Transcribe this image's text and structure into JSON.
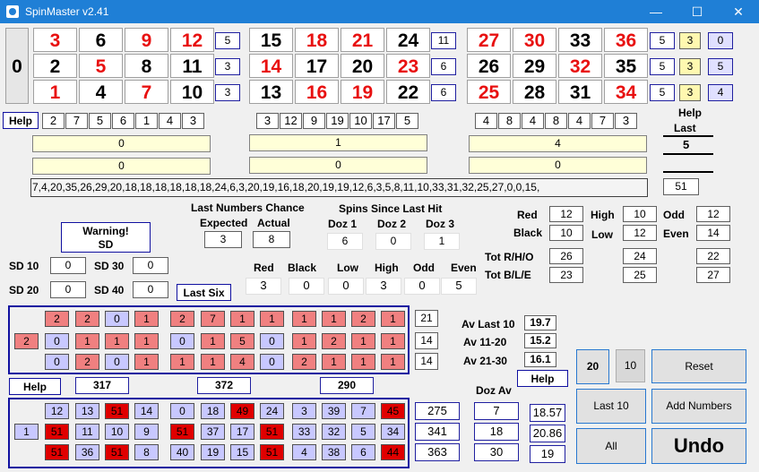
{
  "window": {
    "title": "SpinMaster v2.41",
    "minimize": "—",
    "maximize": "☐",
    "close": "✕"
  },
  "board": {
    "zero": "0",
    "rows": [
      {
        "nums": [
          [
            "3",
            "r"
          ],
          [
            "6",
            "b"
          ],
          [
            "9",
            "r"
          ],
          [
            "12",
            "r"
          ],
          [
            "15",
            "b"
          ],
          [
            "18",
            "r"
          ],
          [
            "21",
            "r"
          ],
          [
            "24",
            "b"
          ],
          [
            "27",
            "r"
          ],
          [
            "30",
            "r"
          ],
          [
            "33",
            "b"
          ],
          [
            "36",
            "r"
          ]
        ]
      },
      {
        "nums": [
          [
            "2",
            "b"
          ],
          [
            "5",
            "r"
          ],
          [
            "8",
            "b"
          ],
          [
            "11",
            "b"
          ],
          [
            "14",
            "r"
          ],
          [
            "17",
            "b"
          ],
          [
            "20",
            "b"
          ],
          [
            "23",
            "r"
          ],
          [
            "26",
            "b"
          ],
          [
            "29",
            "b"
          ],
          [
            "32",
            "r"
          ],
          [
            "35",
            "b"
          ]
        ]
      },
      {
        "nums": [
          [
            "1",
            "r"
          ],
          [
            "4",
            "b"
          ],
          [
            "7",
            "r"
          ],
          [
            "10",
            "b"
          ],
          [
            "13",
            "b"
          ],
          [
            "16",
            "r"
          ],
          [
            "19",
            "r"
          ],
          [
            "22",
            "b"
          ],
          [
            "25",
            "r"
          ],
          [
            "28",
            "b"
          ],
          [
            "31",
            "b"
          ],
          [
            "34",
            "r"
          ]
        ]
      }
    ],
    "dozen_counts": [
      [
        "5",
        "11",
        "5"
      ],
      [
        "3",
        "6",
        "5"
      ],
      [
        "3",
        "6",
        "5"
      ]
    ],
    "col_hits": [
      "3",
      "3",
      "3"
    ],
    "col_counts": [
      "0",
      "5",
      "4"
    ]
  },
  "help_label": "Help",
  "help_last": {
    "help": "Help",
    "last": "Last",
    "value": "5"
  },
  "strip1": [
    "2",
    "7",
    "5",
    "6",
    "1",
    "4",
    "3"
  ],
  "strip2": [
    "3",
    "12",
    "9",
    "19",
    "10",
    "17",
    "5"
  ],
  "strip3": [
    "4",
    "8",
    "4",
    "8",
    "4",
    "7",
    "3"
  ],
  "cream": {
    "a1": "0",
    "a2": "1",
    "a3": "4",
    "b1": "0",
    "b2": "0",
    "b3": "0"
  },
  "history": "7,4,20,35,26,29,20,18,18,18,18,18,18,24,6,3,20,19,16,18,20,19,19,12,6,3,5,8,11,10,33,31,32,25,27,0,0,15,",
  "history_count": "51",
  "warning": {
    "line1": "Warning!",
    "line2": "SD"
  },
  "lnc": {
    "title": "Last Numbers Chance",
    "expected_label": "Expected",
    "actual_label": "Actual",
    "expected": "3",
    "actual": "8"
  },
  "ssh": {
    "title": "Spins Since Last Hit",
    "labels": [
      "Doz 1",
      "Doz 2",
      "Doz 3"
    ],
    "values": [
      "6",
      "0",
      "1"
    ]
  },
  "sd": {
    "sd10_label": "SD 10",
    "sd10": "0",
    "sd30_label": "SD 30",
    "sd30": "0",
    "sd20_label": "SD 20",
    "sd20": "0",
    "sd40_label": "SD 40",
    "sd40": "0"
  },
  "last_six": "Last Six",
  "rbl": {
    "labels": [
      "Red",
      "Black",
      "Low",
      "High",
      "Odd",
      "Even"
    ],
    "values": [
      "3",
      "0",
      "0",
      "3",
      "0",
      "5"
    ]
  },
  "stats": {
    "red_label": "Red",
    "red": "12",
    "black_label": "Black",
    "black": "10",
    "high_label": "High",
    "high": "10",
    "low_label": "Low",
    "low": "12",
    "odd_label": "Odd",
    "odd": "12",
    "even_label": "Even",
    "even": "14",
    "rho_label": "Tot R/H/O",
    "rho": [
      "26",
      "24",
      "22"
    ],
    "ble_label": "Tot B/L/E",
    "ble": [
      "23",
      "25",
      "27"
    ]
  },
  "panel1": {
    "rows": [
      {
        "cells": [
          [
            "2",
            "r"
          ],
          [
            "2",
            "r"
          ],
          [
            "0",
            "b"
          ],
          [
            "1",
            "r"
          ],
          [
            "2",
            "r"
          ],
          [
            "7",
            "r"
          ],
          [
            "1",
            "r"
          ],
          [
            "1",
            "r"
          ],
          [
            "1",
            "r"
          ],
          [
            "1",
            "r"
          ],
          [
            "2",
            "r"
          ],
          [
            "1",
            "r"
          ]
        ],
        "total": "21"
      },
      {
        "cells": [
          [
            "0",
            "b"
          ],
          [
            "1",
            "r"
          ],
          [
            "1",
            "r"
          ],
          [
            "1",
            "r"
          ],
          [
            "0",
            "b"
          ],
          [
            "1",
            "r"
          ],
          [
            "5",
            "r"
          ],
          [
            "0",
            "b"
          ],
          [
            "1",
            "r"
          ],
          [
            "2",
            "r"
          ],
          [
            "1",
            "r"
          ],
          [
            "1",
            "r"
          ]
        ],
        "total": "14"
      },
      {
        "cells": [
          [
            "0",
            "b"
          ],
          [
            "2",
            "r"
          ],
          [
            "0",
            "b"
          ],
          [
            "1",
            "r"
          ],
          [
            "1",
            "r"
          ],
          [
            "1",
            "r"
          ],
          [
            "4",
            "r"
          ],
          [
            "0",
            "b"
          ],
          [
            "2",
            "r"
          ],
          [
            "1",
            "r"
          ],
          [
            "1",
            "r"
          ],
          [
            "1",
            "r"
          ]
        ],
        "total": "14"
      }
    ],
    "zero": "2"
  },
  "av": {
    "l10_label": "Av Last 10",
    "l10": "19.7",
    "l1120_label": "Av 11-20",
    "l1120": "15.2",
    "l2130_label": "Av 21-30",
    "l2130": "16.1"
  },
  "mid": {
    "help": "Help",
    "v1": "317",
    "v2": "372",
    "v3": "290",
    "help2": "Help",
    "doz_av": "Doz Av"
  },
  "panel2": {
    "rows": [
      {
        "cells": [
          [
            "12",
            "b"
          ],
          [
            "13",
            "b"
          ],
          [
            "51",
            "d"
          ],
          [
            "14",
            "b"
          ],
          [
            "0",
            "b"
          ],
          [
            "18",
            "b"
          ],
          [
            "49",
            "d"
          ],
          [
            "24",
            "b"
          ],
          [
            "3",
            "b"
          ],
          [
            "39",
            "b"
          ],
          [
            "7",
            "b"
          ],
          [
            "45",
            "d"
          ]
        ],
        "total": "275",
        "doz": "7",
        "av": "18.57"
      },
      {
        "cells": [
          [
            "51",
            "d"
          ],
          [
            "11",
            "b"
          ],
          [
            "10",
            "b"
          ],
          [
            "9",
            "b"
          ],
          [
            "51",
            "d"
          ],
          [
            "37",
            "b"
          ],
          [
            "17",
            "b"
          ],
          [
            "51",
            "d"
          ],
          [
            "33",
            "b"
          ],
          [
            "32",
            "b"
          ],
          [
            "5",
            "b"
          ],
          [
            "34",
            "b"
          ]
        ],
        "total": "341",
        "doz": "18",
        "av": "20.86"
      },
      {
        "cells": [
          [
            "51",
            "d"
          ],
          [
            "36",
            "b"
          ],
          [
            "51",
            "d"
          ],
          [
            "8",
            "b"
          ],
          [
            "40",
            "b"
          ],
          [
            "19",
            "b"
          ],
          [
            "15",
            "b"
          ],
          [
            "51",
            "d"
          ],
          [
            "4",
            "b"
          ],
          [
            "38",
            "b"
          ],
          [
            "6",
            "b"
          ],
          [
            "44",
            "d"
          ]
        ],
        "total": "363",
        "doz": "30",
        "av": "19"
      }
    ],
    "zero": "1"
  },
  "buttons": {
    "b20": "20",
    "b10": "10",
    "reset": "Reset",
    "last10": "Last 10",
    "add": "Add Numbers",
    "all": "All",
    "undo": "Undo"
  },
  "colors": {
    "titlebar": "#1f7fd6",
    "red_num": "#e81010",
    "hit_red": "#f08080",
    "hit_blue": "#c8c8ff",
    "cold": "#e00000",
    "cream": "#ffffd8"
  }
}
